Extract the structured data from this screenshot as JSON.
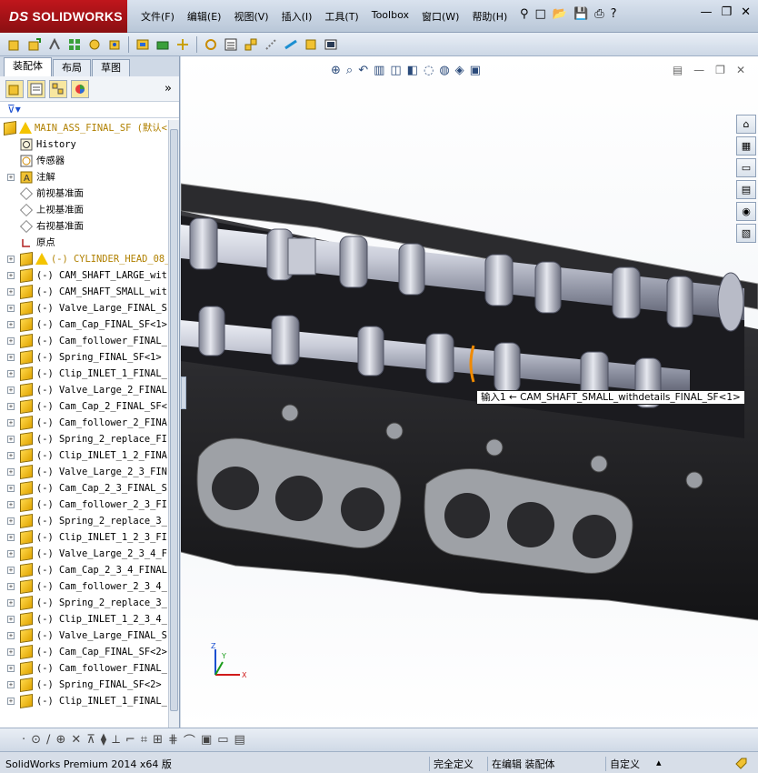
{
  "app": {
    "logo_mark": "DS",
    "logo_text": "SOLIDWORKS"
  },
  "menus": [
    "文件(F)",
    "编辑(E)",
    "视图(V)",
    "插入(I)",
    "工具(T)",
    "Toolbox",
    "窗口(W)",
    "帮助(H)"
  ],
  "title_tools": {
    "pin": "⚲",
    "new": "□",
    "open": "📂",
    "save": "💾",
    "print": "⎙",
    "help": "?"
  },
  "window_controls": {
    "minimize": "—",
    "restore": "❐",
    "close": "✕"
  },
  "panel": {
    "tabs": [
      "装配体",
      "布局",
      "草图"
    ],
    "active_tab": "装配体",
    "fm_more": "»",
    "filter": "⊽▾"
  },
  "tree": [
    {
      "label": "MAIN_ASS_FINAL_SF  (默认<",
      "icon": "cube-warning",
      "expand": "-",
      "level": 0,
      "color": "#b08000"
    },
    {
      "label": "History",
      "icon": "history",
      "expand": "",
      "level": 1
    },
    {
      "label": "传感器",
      "icon": "sensor",
      "expand": "",
      "level": 1
    },
    {
      "label": "注解",
      "icon": "annotation",
      "expand": "+",
      "level": 1
    },
    {
      "label": "前视基准面",
      "icon": "plane",
      "expand": "",
      "level": 1
    },
    {
      "label": "上视基准面",
      "icon": "plane",
      "expand": "",
      "level": 1
    },
    {
      "label": "右视基准面",
      "icon": "plane",
      "expand": "",
      "level": 1
    },
    {
      "label": "原点",
      "icon": "origin",
      "expand": "",
      "level": 1
    },
    {
      "label": "(-) CYLINDER_HEAD_08_",
      "icon": "cube-warning",
      "expand": "+",
      "level": 1,
      "color": "#b08000"
    },
    {
      "label": "(-) CAM_SHAFT_LARGE_wit",
      "icon": "cube",
      "expand": "+",
      "level": 1
    },
    {
      "label": "(-) CAM_SHAFT_SMALL_wit",
      "icon": "cube",
      "expand": "+",
      "level": 1
    },
    {
      "label": "(-) Valve_Large_FINAL_S",
      "icon": "cube",
      "expand": "+",
      "level": 1
    },
    {
      "label": "(-) Cam_Cap_FINAL_SF<1>",
      "icon": "cube",
      "expand": "+",
      "level": 1
    },
    {
      "label": "(-) Cam_follower_FINAL_",
      "icon": "cube",
      "expand": "+",
      "level": 1
    },
    {
      "label": "(-) Spring_FINAL_SF<1>",
      "icon": "cube",
      "expand": "+",
      "level": 1
    },
    {
      "label": "(-) Clip_INLET_1_FINAL_",
      "icon": "cube",
      "expand": "+",
      "level": 1
    },
    {
      "label": "(-) Valve_Large_2_FINAL",
      "icon": "cube",
      "expand": "+",
      "level": 1
    },
    {
      "label": "(-) Cam_Cap_2_FINAL_SF<",
      "icon": "cube",
      "expand": "+",
      "level": 1
    },
    {
      "label": "(-) Cam_follower_2_FINA",
      "icon": "cube",
      "expand": "+",
      "level": 1
    },
    {
      "label": "(-) Spring_2_replace_FI",
      "icon": "cube",
      "expand": "+",
      "level": 1
    },
    {
      "label": "(-) Clip_INLET_1_2_FINA",
      "icon": "cube",
      "expand": "+",
      "level": 1
    },
    {
      "label": "(-) Valve_Large_2_3_FIN",
      "icon": "cube",
      "expand": "+",
      "level": 1
    },
    {
      "label": "(-) Cam_Cap_2_3_FINAL_S",
      "icon": "cube",
      "expand": "+",
      "level": 1
    },
    {
      "label": "(-) Cam_follower_2_3_FI",
      "icon": "cube",
      "expand": "+",
      "level": 1
    },
    {
      "label": "(-) Spring_2_replace_3_",
      "icon": "cube",
      "expand": "+",
      "level": 1
    },
    {
      "label": "(-) Clip_INLET_1_2_3_FI",
      "icon": "cube",
      "expand": "+",
      "level": 1
    },
    {
      "label": "(-) Valve_Large_2_3_4_F",
      "icon": "cube",
      "expand": "+",
      "level": 1
    },
    {
      "label": "(-) Cam_Cap_2_3_4_FINAL",
      "icon": "cube",
      "expand": "+",
      "level": 1
    },
    {
      "label": "(-) Cam_follower_2_3_4_",
      "icon": "cube",
      "expand": "+",
      "level": 1
    },
    {
      "label": "(-) Spring_2_replace_3_",
      "icon": "cube",
      "expand": "+",
      "level": 1
    },
    {
      "label": "(-) Clip_INLET_1_2_3_4_",
      "icon": "cube",
      "expand": "+",
      "level": 1
    },
    {
      "label": "(-) Valve_Large_FINAL_S",
      "icon": "cube",
      "expand": "+",
      "level": 1
    },
    {
      "label": "(-) Cam_Cap_FINAL_SF<2>",
      "icon": "cube",
      "expand": "+",
      "level": 1
    },
    {
      "label": "(-) Cam_follower_FINAL_",
      "icon": "cube",
      "expand": "+",
      "level": 1
    },
    {
      "label": "(-) Spring_FINAL_SF<2>",
      "icon": "cube",
      "expand": "+",
      "level": 1
    },
    {
      "label": "(-) Clip_INLET_1_FINAL_",
      "icon": "cube",
      "expand": "+",
      "level": 1
    }
  ],
  "viewport": {
    "tooltip": "输入1  ← CAM_SHAFT_SMALL_withdetails_FINAL_SF<1>",
    "triad": {
      "x": "X",
      "y": "Y",
      "z": "Z"
    }
  },
  "status": {
    "product": "SolidWorks Premium 2014 x64 版",
    "definition": "完全定义",
    "mode": "在编辑 装配体",
    "units": "自定义",
    "arrow": "▴"
  }
}
